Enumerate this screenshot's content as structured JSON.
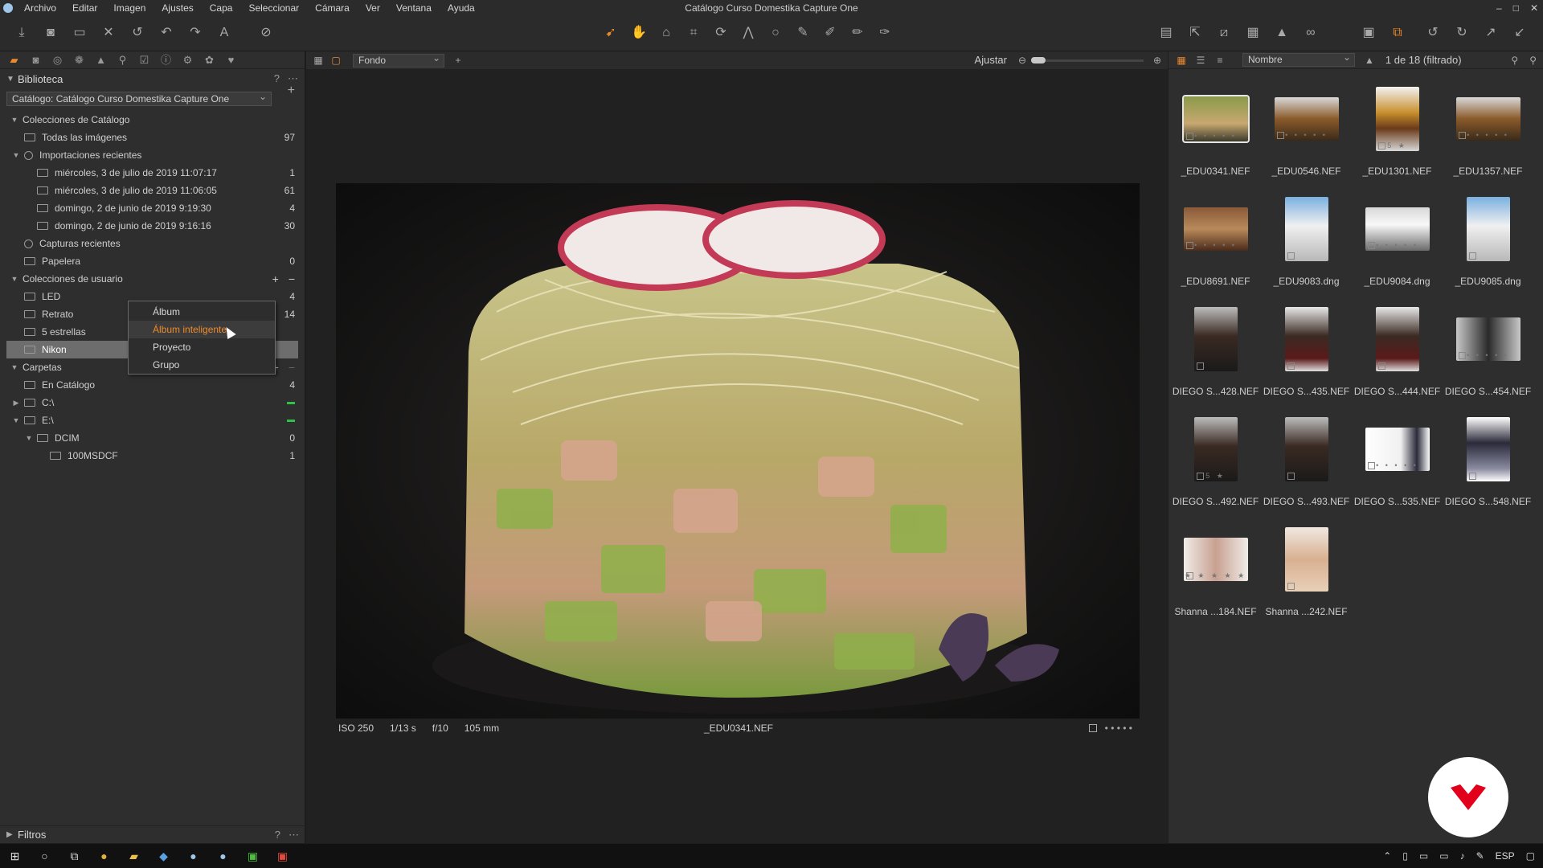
{
  "window": {
    "title": "Catálogo Curso Domestika Capture One",
    "controls": [
      "–",
      "□",
      "✕"
    ]
  },
  "menu": [
    "Archivo",
    "Editar",
    "Imagen",
    "Ajustes",
    "Capa",
    "Seleccionar",
    "Cámara",
    "Ver",
    "Ventana",
    "Ayuda"
  ],
  "library": {
    "title": "Biblioteca",
    "catalog_select": "Catálogo: Catálogo Curso Domestika Capture One",
    "catalog_collections": {
      "title": "Colecciones de Catálogo",
      "items": [
        {
          "label": "Todas las imágenes",
          "count": "97"
        },
        {
          "label": "Importaciones recientes",
          "count": ""
        },
        {
          "label": "miércoles, 3 de julio de 2019 11:07:17",
          "count": "1"
        },
        {
          "label": "miércoles, 3 de julio de 2019 11:06:05",
          "count": "61"
        },
        {
          "label": "domingo, 2 de junio de 2019 9:19:30",
          "count": "4"
        },
        {
          "label": "domingo, 2 de junio de 2019 9:16:16",
          "count": "30"
        },
        {
          "label": "Capturas recientes",
          "count": ""
        },
        {
          "label": "Papelera",
          "count": "0"
        }
      ]
    },
    "user_collections": {
      "title": "Colecciones de usuario",
      "items": [
        {
          "label": "LED",
          "count": "4"
        },
        {
          "label": "Retrato",
          "count": "14"
        },
        {
          "label": "5 estrellas",
          "count": ""
        },
        {
          "label": "Nikon",
          "count": ""
        }
      ]
    },
    "folders": {
      "title": "Carpetas",
      "items": [
        {
          "label": "En Catálogo",
          "count": "4"
        },
        {
          "label": "C:\\",
          "count": ""
        },
        {
          "label": "E:\\",
          "count": ""
        },
        {
          "label": "DCIM",
          "count": "0"
        },
        {
          "label": "100MSDCF",
          "count": "1"
        }
      ]
    },
    "filters_title": "Filtros"
  },
  "context_menu": [
    "Álbum",
    "Álbum inteligente",
    "Proyecto",
    "Grupo"
  ],
  "viewer": {
    "background_select": "Fondo",
    "fit_label": "Ajustar",
    "exif": {
      "iso": "ISO 250",
      "shutter": "1/13 s",
      "aperture": "f/10",
      "focal": "105 mm"
    },
    "filename": "_EDU0341.NEF",
    "rating_dots": "• • • • •"
  },
  "browser": {
    "sort_select": "Nombre",
    "count_text": "1 de 18 (filtrado)",
    "thumbnails": [
      {
        "name": "_EDU0341.NEF",
        "kind": "food-salad",
        "stars": "• • • • •"
      },
      {
        "name": "_EDU0546.NEF",
        "kind": "food-burger",
        "stars": "• • • • •"
      },
      {
        "name": "_EDU1301.NEF",
        "kind": "food-burger-v",
        "stars": "5 ★"
      },
      {
        "name": "_EDU1357.NEF",
        "kind": "food-burger",
        "stars": "• • • • •"
      },
      {
        "name": "_EDU8691.NEF",
        "kind": "food-wood",
        "stars": "• • • • •"
      },
      {
        "name": "_EDU9083.dng",
        "kind": "house-v",
        "stars": ""
      },
      {
        "name": "_EDU9084.dng",
        "kind": "house",
        "stars": "• • • • •"
      },
      {
        "name": "_EDU9085.dng",
        "kind": "house-v",
        "stars": ""
      },
      {
        "name": "DIEGO S...428.NEF",
        "kind": "portrait-v",
        "stars": ""
      },
      {
        "name": "DIEGO S...435.NEF",
        "kind": "portrait-light-v",
        "stars": ""
      },
      {
        "name": "DIEGO S...444.NEF",
        "kind": "portrait-light-v",
        "stars": ""
      },
      {
        "name": "DIEGO S...454.NEF",
        "kind": "portrait-h",
        "stars": "• • • • •"
      },
      {
        "name": "DIEGO S...492.NEF",
        "kind": "portrait-v",
        "stars": "5 ★"
      },
      {
        "name": "DIEGO S...493.NEF",
        "kind": "portrait-v",
        "stars": ""
      },
      {
        "name": "DIEGO S...535.NEF",
        "kind": "portrait-white-h",
        "stars": "• • • • •"
      },
      {
        "name": "DIEGO S...548.NEF",
        "kind": "portrait-white-v",
        "stars": ""
      },
      {
        "name": "Shanna ...184.NEF",
        "kind": "face-h",
        "stars": "★ ★ ★ ★ ★"
      },
      {
        "name": "Shanna ...242.NEF",
        "kind": "face-v",
        "stars": ""
      }
    ]
  },
  "taskbar": {
    "language": "ESP"
  },
  "colors": {
    "accent": "#ee8a2b",
    "selection": "#6d6d6d",
    "panel": "#2e2e2e",
    "viewer": "#212121",
    "green": "#2ec14a"
  }
}
